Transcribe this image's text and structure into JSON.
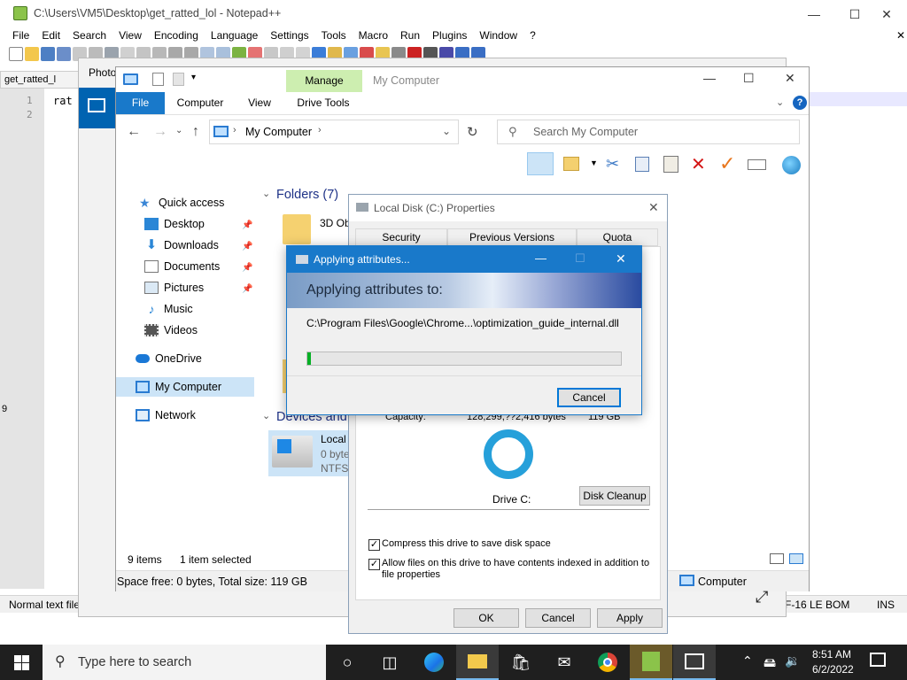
{
  "notepad": {
    "title": "C:\\Users\\VM5\\Desktop\\get_ratted_lol - Notepad++",
    "menu": [
      "File",
      "Edit",
      "Search",
      "View",
      "Encoding",
      "Language",
      "Settings",
      "Tools",
      "Macro",
      "Run",
      "Plugins",
      "Window",
      "?"
    ],
    "tab": "get_ratted_l",
    "lines": [
      "1",
      "2"
    ],
    "code": "rat",
    "status_left": "Normal text file",
    "status_encoding": "F-16 LE BOM",
    "status_mode": "INS"
  },
  "photos": {
    "title": "Photo"
  },
  "explorer": {
    "title": "My Computer",
    "manage_tab": "Manage",
    "tabs": {
      "file": "File",
      "computer": "Computer",
      "view": "View",
      "drive_tools": "Drive Tools"
    },
    "address": "My Computer",
    "search_placeholder": "Search My Computer",
    "nav": {
      "quick_access": "Quick access",
      "desktop": "Desktop",
      "downloads": "Downloads",
      "documents": "Documents",
      "pictures": "Pictures",
      "music": "Music",
      "videos": "Videos",
      "onedrive": "OneDrive",
      "my_computer": "My Computer",
      "network": "Network"
    },
    "folders_header": "Folders (7)",
    "folder_first": "3D Ob",
    "devices_header": "Devices and",
    "drive": {
      "name": "Local",
      "line2": "0 byte",
      "line3": "NTFS"
    },
    "status_items": "9 items",
    "status_selected": "1 item selected",
    "space_info": "Space free: 0 bytes, Total size: 119 GB",
    "bottom_right": "Computer"
  },
  "properties": {
    "title": "Local Disk (C:) Properties",
    "tabs": [
      "Security",
      "Previous Versions",
      "Quota"
    ],
    "capacity_label": "Capacity:",
    "capacity_bytes": "128,299,??2,416 bytes",
    "capacity_gb": "119 GB",
    "drive_label": "Drive C:",
    "disk_cleanup": "Disk Cleanup",
    "compress_label": "Compress this drive to save disk space",
    "index_label": "Allow files on this drive to have contents indexed in addition to file properties",
    "ok": "OK",
    "cancel": "Cancel",
    "apply": "Apply"
  },
  "apply_dialog": {
    "title": "Applying attributes...",
    "heading": "Applying attributes to:",
    "path": "C:\\Program Files\\Google\\Chrome...\\optimization_guide_internal.dll",
    "progress_percent": 1,
    "cancel": "Cancel"
  },
  "taskbar": {
    "search_placeholder": "Type here to search",
    "time": "8:51 AM",
    "date": "6/2/2022"
  },
  "colors": {
    "accent": "#1979ca",
    "file_tab": "#1979ca",
    "manage_tab": "#cdeeb0",
    "progress": "#06b025",
    "taskbar": "#1f1f1f"
  }
}
